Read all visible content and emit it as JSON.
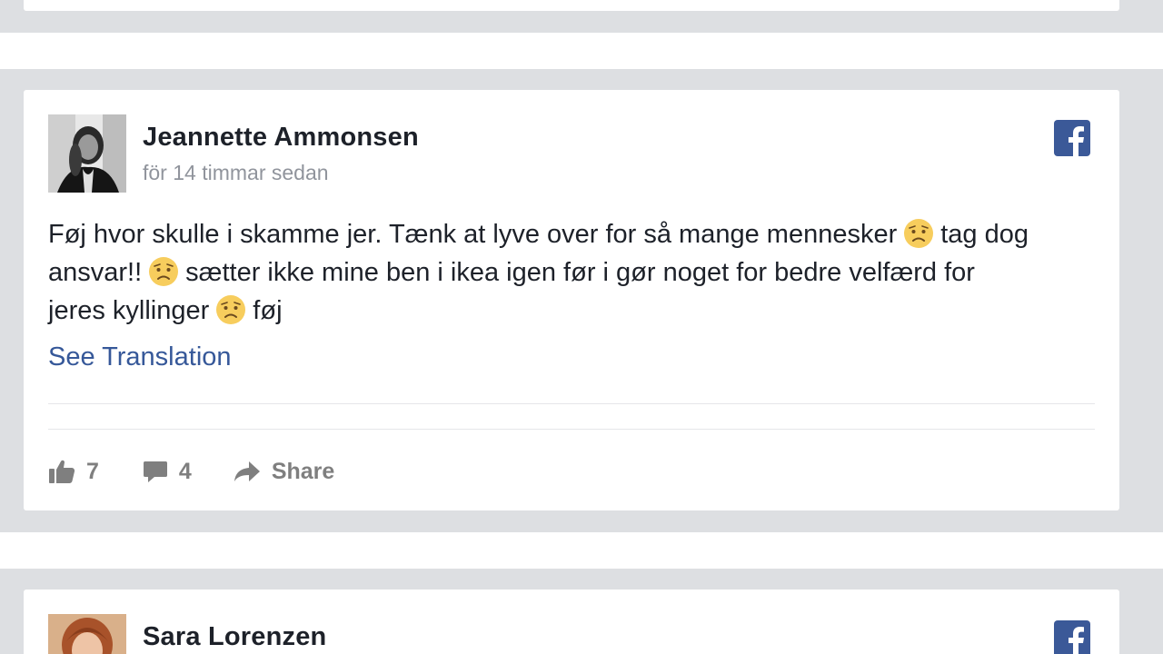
{
  "posts": [
    {
      "author": "Jeannette Ammonsen",
      "time": "för 14 timmar sedan",
      "text_line1_before": "Føj hvor skulle i skamme jer. Tænk at lyve over for så mange mennesker",
      "text_line1_after": "tag dog",
      "text_line2_before": "ansvar!!",
      "text_line2_after": "sætter ikke mine ben i ikea igen før i gør noget for bedre velfærd for",
      "text_line3_before": "jeres kyllinger",
      "text_line3_after": "føj",
      "emoji": "worried-face-emoji",
      "see_translation": "See Translation",
      "likes": "7",
      "comments": "4",
      "share_label": "Share"
    },
    {
      "author": "Sara Lorenzen"
    }
  ],
  "icons": {
    "facebook": "facebook-logo-icon",
    "like": "thumbs-up-icon",
    "comment": "comment-bubble-icon",
    "share": "share-arrow-icon"
  },
  "colors": {
    "page_band": "#dddfe2",
    "facebook_blue": "#3b5998",
    "link_blue": "#365899",
    "meta_gray": "#90949c",
    "action_gray": "#7f7f7f"
  }
}
